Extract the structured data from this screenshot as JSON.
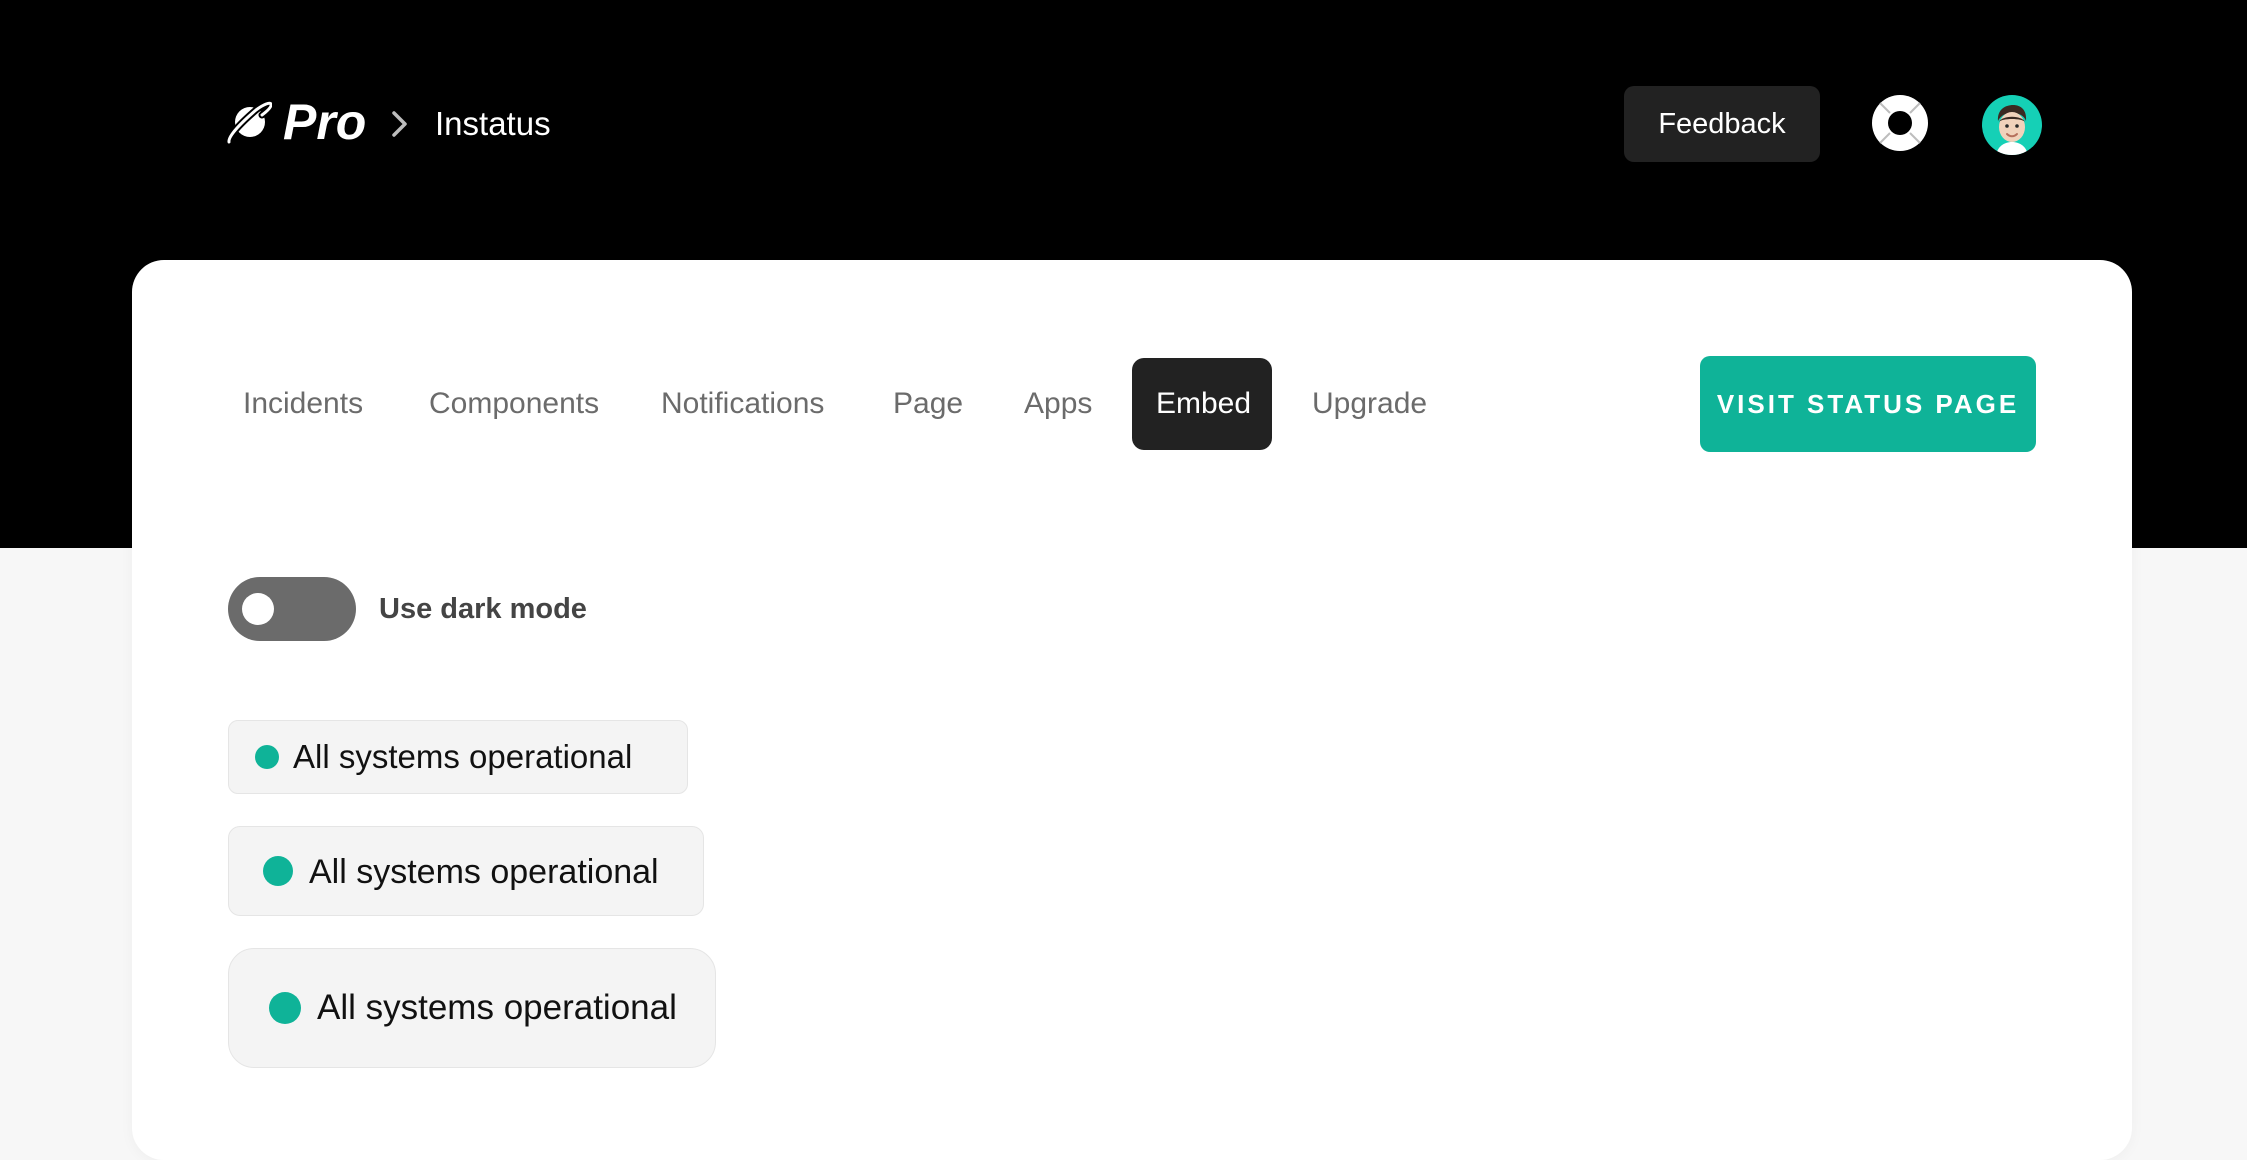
{
  "header": {
    "brand": "Pro",
    "breadcrumb_label": "Instatus",
    "feedback_label": "Feedback"
  },
  "nav": {
    "tabs": [
      {
        "label": "Incidents",
        "active": false
      },
      {
        "label": "Components",
        "active": false
      },
      {
        "label": "Notifications",
        "active": false
      },
      {
        "label": "Page",
        "active": false
      },
      {
        "label": "Apps",
        "active": false
      },
      {
        "label": "Embed",
        "active": true
      },
      {
        "label": "Upgrade",
        "active": false
      }
    ],
    "visit_button_label": "VISIT STATUS PAGE"
  },
  "settings": {
    "dark_mode_label": "Use dark mode",
    "dark_mode_enabled": false
  },
  "badges": [
    {
      "size": "small",
      "text": "All systems operational"
    },
    {
      "size": "medium",
      "text": "All systems operational"
    },
    {
      "size": "large",
      "text": "All systems operational"
    }
  ],
  "colors": {
    "accent": "#0fb398",
    "header_bg": "#000000",
    "active_tab_bg": "#222222",
    "avatar_bg": "#15d0b6"
  },
  "icons": {
    "logo": "planet-icon",
    "breadcrumb_separator": "chevron-right-icon",
    "help": "lifebuoy-icon",
    "avatar": "memoji-avatar"
  }
}
